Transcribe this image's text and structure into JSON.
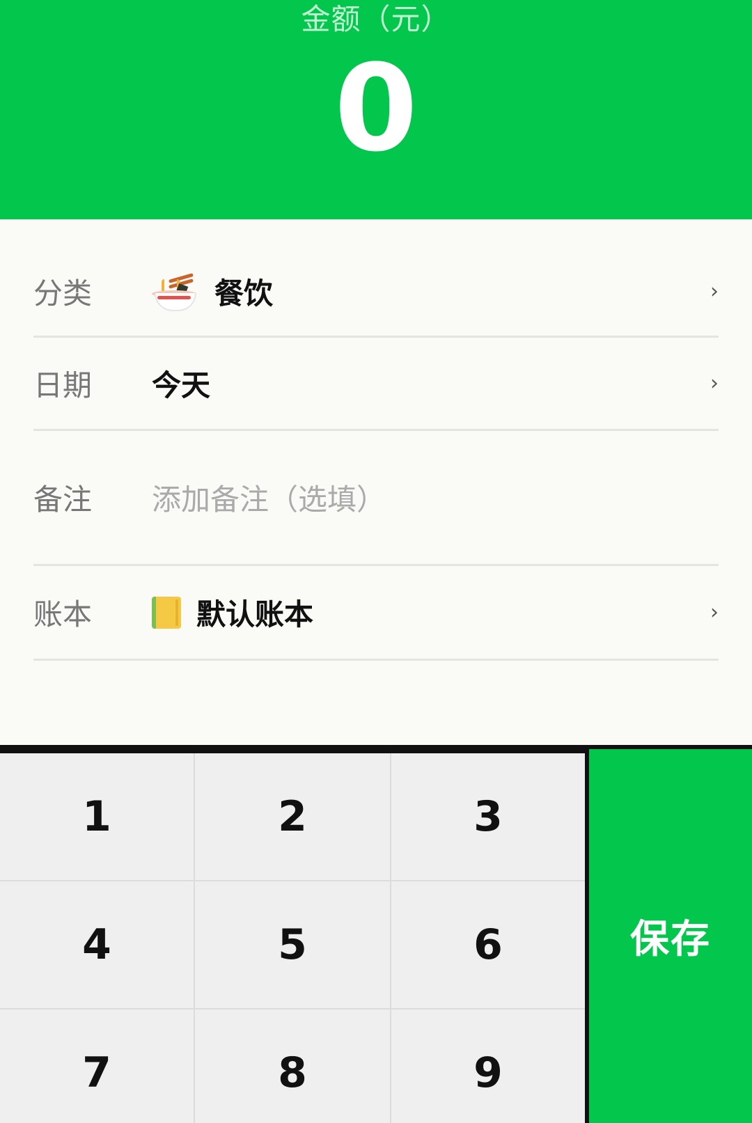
{
  "header": {
    "amount_label": "金额（元）",
    "amount_value": "0"
  },
  "form": {
    "category": {
      "label": "分类",
      "icon": "noodle-bowl-icon",
      "value": "餐饮"
    },
    "date": {
      "label": "日期",
      "value": "今天"
    },
    "note": {
      "label": "备注",
      "placeholder": "添加备注（选填）"
    },
    "ledger": {
      "label": "账本",
      "icon": "notebook-icon",
      "value": "默认账本"
    },
    "chevron": "›"
  },
  "keypad": {
    "keys": [
      "1",
      "2",
      "3",
      "4",
      "5",
      "6",
      "7",
      "8",
      "9"
    ],
    "save_label": "保存"
  },
  "colors": {
    "accent": "#02c74c",
    "background": "#fafaf7",
    "key_bg": "#efefef"
  }
}
